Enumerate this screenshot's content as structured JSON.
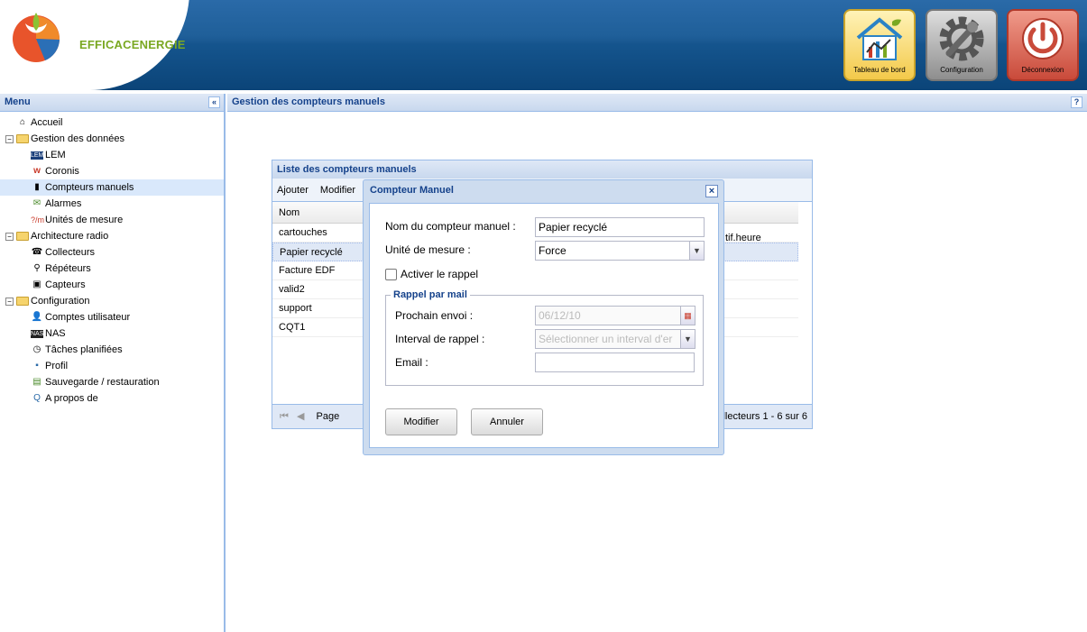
{
  "header": {
    "brand": "EFFICACENERGIE",
    "buttons": {
      "dashboard": "Tableau de  bord",
      "configuration": "Configuration",
      "logout": "Déconnexion"
    }
  },
  "sidebar": {
    "title": "Menu",
    "collapse_glyph": "«",
    "items": [
      {
        "label": "Accueil",
        "icon": "home-icon"
      },
      {
        "label": "Gestion des données",
        "icon": "folder-icon"
      },
      {
        "label": "LEM",
        "icon": "lem-icon"
      },
      {
        "label": "Coronis",
        "icon": "coronis-icon"
      },
      {
        "label": "Compteurs manuels",
        "icon": "meter-icon"
      },
      {
        "label": "Alarmes",
        "icon": "envelope-icon"
      },
      {
        "label": "Unités de mesure",
        "icon": "units-icon"
      },
      {
        "label": "Architecture radio",
        "icon": "folder-icon"
      },
      {
        "label": "Collecteurs",
        "icon": "collector-icon"
      },
      {
        "label": "Répéteurs",
        "icon": "repeater-icon"
      },
      {
        "label": "Capteurs",
        "icon": "sensor-icon"
      },
      {
        "label": "Configuration",
        "icon": "folder-icon"
      },
      {
        "label": "Comptes utilisateur",
        "icon": "user-icon"
      },
      {
        "label": "NAS",
        "icon": "nas-icon"
      },
      {
        "label": "Tâches planifiées",
        "icon": "clock-icon"
      },
      {
        "label": "Profil",
        "icon": "profile-icon"
      },
      {
        "label": "Sauvegarde / restauration",
        "icon": "save-icon"
      },
      {
        "label": "A propos de",
        "icon": "about-icon"
      }
    ]
  },
  "main": {
    "title": "Gestion des compteurs manuels",
    "help_glyph": "?"
  },
  "grid": {
    "title": "Liste des compteurs manuels",
    "toolbar": {
      "add": "Ajouter",
      "edit": "Modifier"
    },
    "column": "Nom",
    "rows": [
      "cartouches",
      "Papier recyclé",
      "Facture EDF",
      "valid2",
      "support",
      "CQT1"
    ],
    "partial_cell": "tif.heure",
    "pager": {
      "page_label": "Page",
      "status": "llecteurs 1 - 6 sur 6"
    }
  },
  "dialog": {
    "title": "Compteur Manuel",
    "close_glyph": "×",
    "name_label": "Nom du compteur manuel :",
    "name_value": "Papier recyclé",
    "unit_label": "Unité de mesure :",
    "unit_value": "Force",
    "reminder_label": "Activer le rappel",
    "reminder_checked": false,
    "fieldset_title": "Rappel par mail",
    "next_label": "Prochain envoi :",
    "next_value": "06/12/10",
    "interval_label": "Interval de rappel :",
    "interval_placeholder": "Sélectionner un interval d'er",
    "email_label": "Email :",
    "email_value": "",
    "modify_button": "Modifier",
    "cancel_button": "Annuler"
  }
}
